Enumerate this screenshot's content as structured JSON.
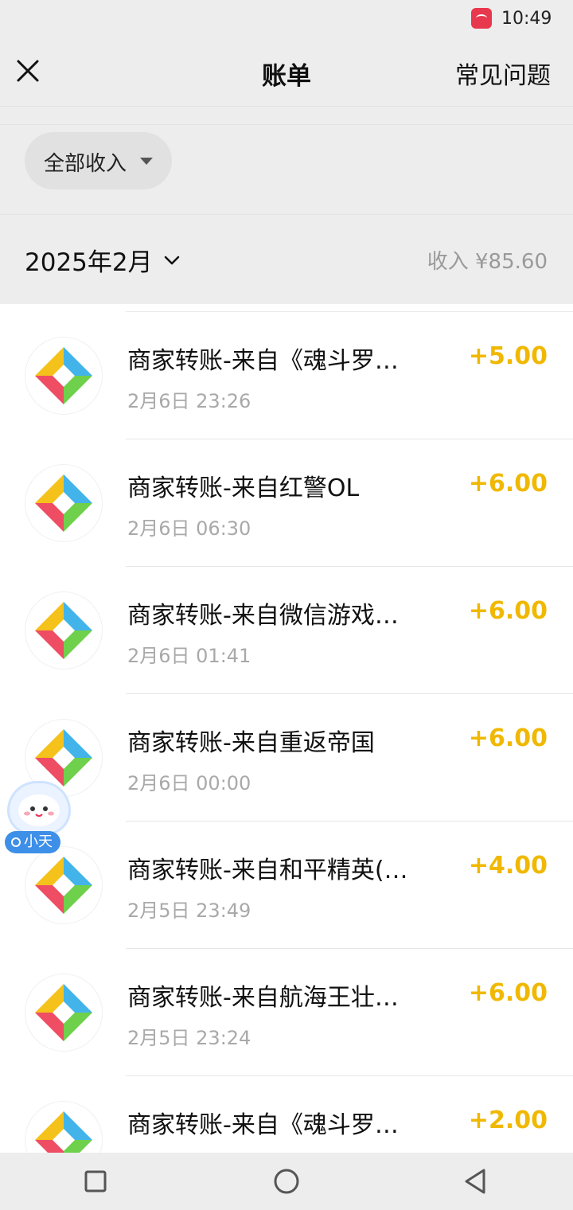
{
  "status_bar": {
    "time": "10:49",
    "app_icon": "huawei-store-icon"
  },
  "header": {
    "title": "账单",
    "faq_label": "常见问题",
    "close_icon": "close-icon"
  },
  "filter": {
    "label": "全部收入",
    "icon": "caret-down-icon"
  },
  "month": {
    "label": "2025年2月",
    "income_summary": "收入 ¥85.60"
  },
  "transactions": [
    {
      "title": "商家转账-来自《魂斗罗…",
      "time": "2月6日 23:26",
      "amount": "+5.00"
    },
    {
      "title": "商家转账-来自红警OL",
      "time": "2月6日 06:30",
      "amount": "+6.00"
    },
    {
      "title": "商家转账-来自微信游戏…",
      "time": "2月6日 01:41",
      "amount": "+6.00"
    },
    {
      "title": "商家转账-来自重返帝国",
      "time": "2月6日 00:00",
      "amount": "+6.00"
    },
    {
      "title": "商家转账-来自和平精英(…",
      "time": "2月5日 23:49",
      "amount": "+4.00"
    },
    {
      "title": "商家转账-来自航海王壮…",
      "time": "2月5日 23:24",
      "amount": "+6.00"
    },
    {
      "title": "商家转账-来自《魂斗罗…",
      "time": "",
      "amount": "+2.00"
    }
  ],
  "assistant": {
    "label": "小天"
  },
  "colors": {
    "amount": "#f0b800",
    "background": "#ededed",
    "assistant": "#3d8fe8"
  }
}
